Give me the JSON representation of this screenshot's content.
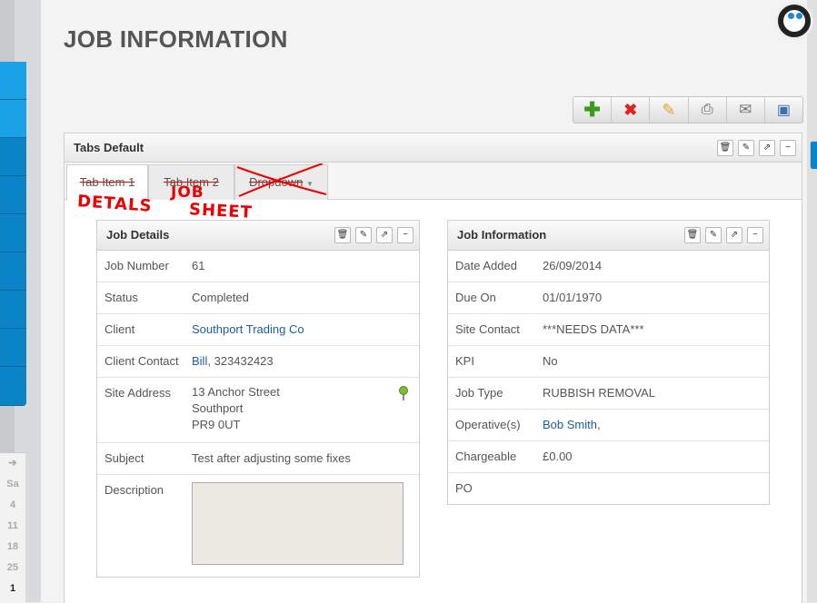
{
  "page": {
    "title": "JOB INFORMATION"
  },
  "calendar": {
    "arrow": "➔",
    "days": [
      "Sa",
      "4",
      "11",
      "18",
      "25",
      "1"
    ]
  },
  "toolbar": {
    "icons": [
      "add-icon",
      "delete-icon",
      "edit-icon",
      "print-icon",
      "email-icon",
      "save-icon"
    ]
  },
  "tabs_panel": {
    "title": "Tabs Default",
    "tabs": [
      {
        "label": "Tab Item 1"
      },
      {
        "label": "Tab Item 2"
      },
      {
        "label": "Dropdown"
      }
    ],
    "annotations": {
      "details": "DETALS",
      "job": "JOB",
      "sheet": "SHEET"
    }
  },
  "job_details": {
    "title": "Job Details",
    "rows": {
      "job_number": {
        "label": "Job Number",
        "value": "61"
      },
      "status": {
        "label": "Status",
        "value": "Completed"
      },
      "client": {
        "label": "Client",
        "value": "Southport Trading Co"
      },
      "client_contact": {
        "label": "Client Contact",
        "name": "Bill",
        "phone": ", 323432423"
      },
      "site_address": {
        "label": "Site Address",
        "line1": "13 Anchor Street",
        "line2": "Southport",
        "line3": "PR9 0UT"
      },
      "subject": {
        "label": "Subject",
        "value": "Test after adjusting some fixes"
      },
      "description": {
        "label": "Description",
        "value": ""
      }
    }
  },
  "job_information": {
    "title": "Job Information",
    "rows": {
      "date_added": {
        "label": "Date Added",
        "value": "26/09/2014"
      },
      "due_on": {
        "label": "Due On",
        "value": "01/01/1970"
      },
      "site_contact": {
        "label": "Site Contact",
        "value": "***NEEDS DATA***"
      },
      "kpi": {
        "label": "KPI",
        "value": "No"
      },
      "job_type": {
        "label": "Job Type",
        "value": "RUBBISH REMOVAL"
      },
      "operatives": {
        "label": "Operative(s)",
        "value": "Bob Smith",
        "suffix": ","
      },
      "chargeable": {
        "label": "Chargeable",
        "value": "£0.00"
      },
      "po": {
        "label": "PO",
        "value": ""
      }
    }
  },
  "colors": {
    "accent": "#0a84c6",
    "link": "#1a5f9c",
    "annotation": "#e00000"
  }
}
